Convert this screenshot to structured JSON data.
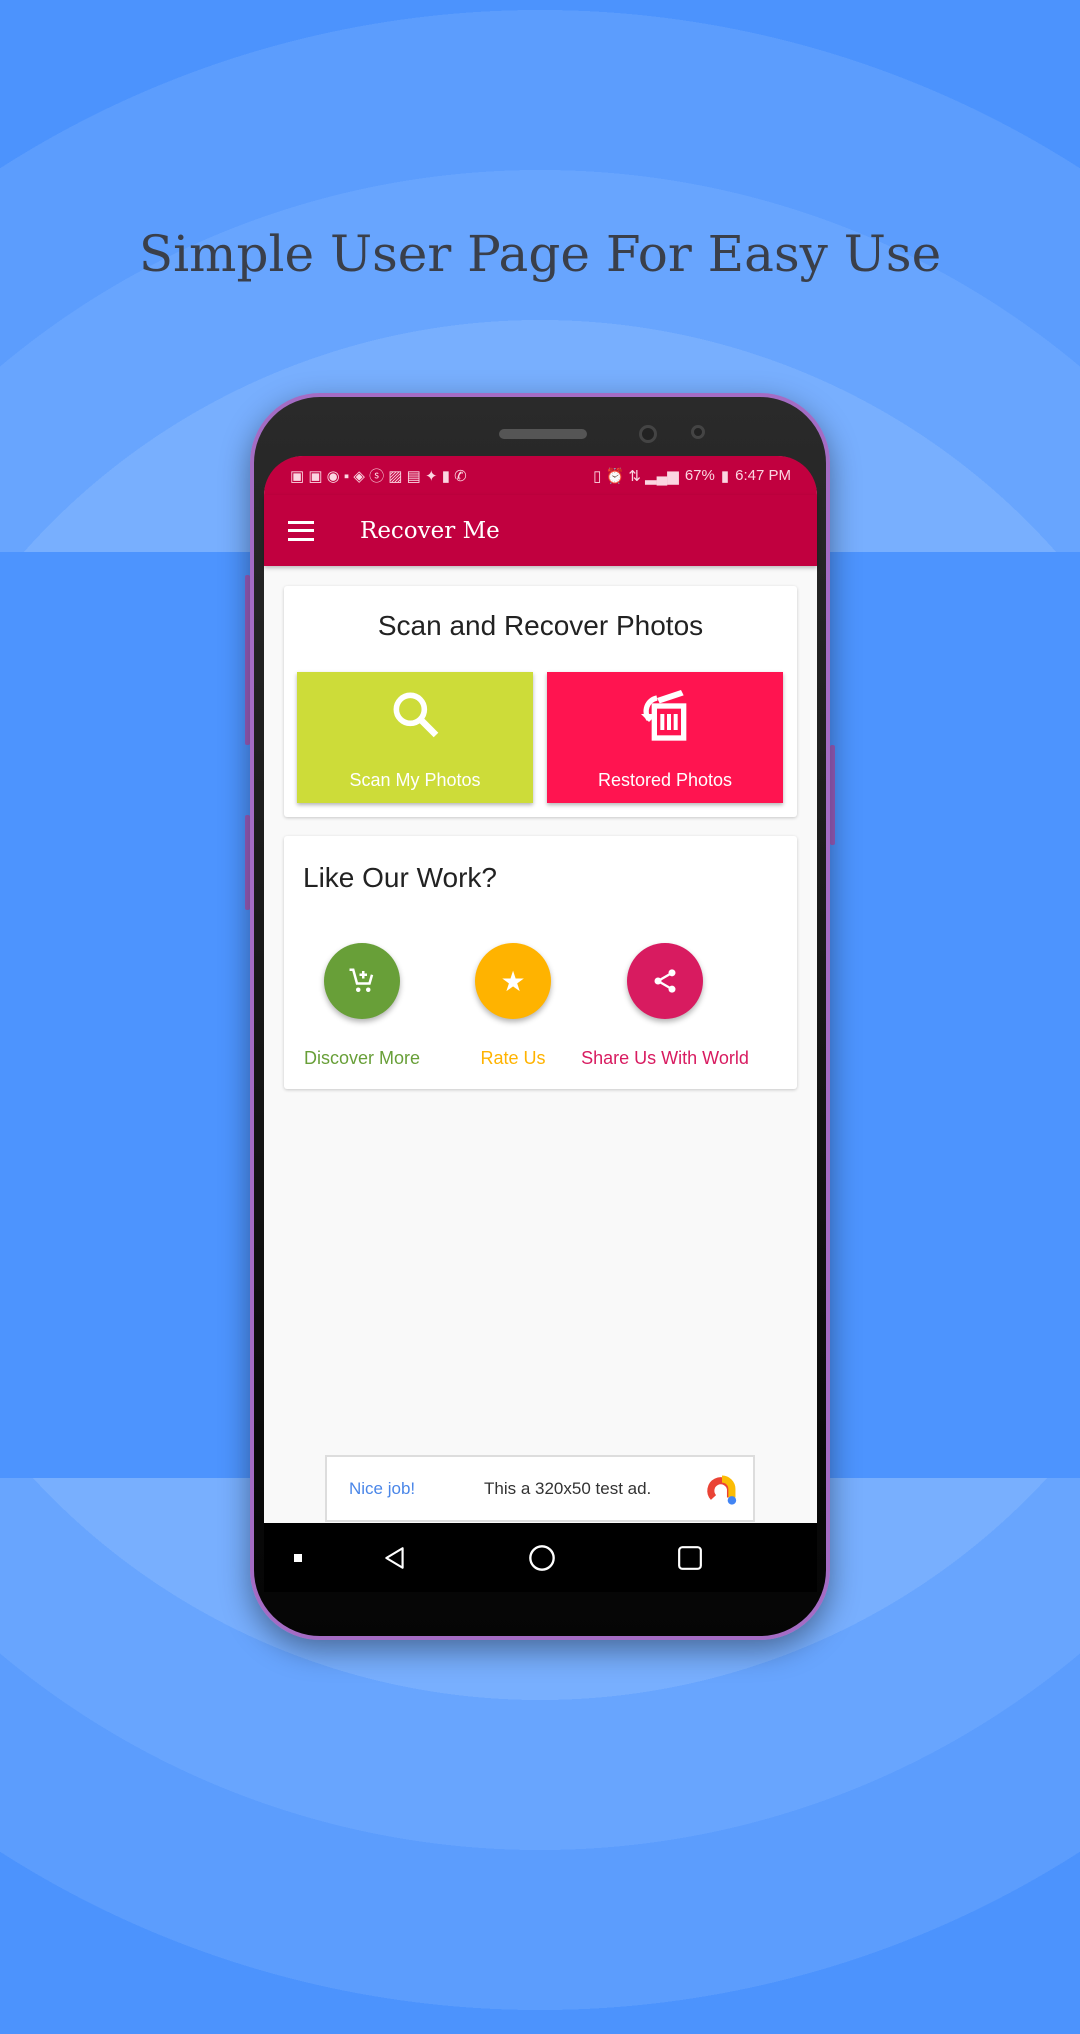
{
  "headline": "Simple User Page For Easy Use",
  "colors": {
    "background": "#4c93fd",
    "app_bar": "#c1003f",
    "scan": "#cddc39",
    "restored": "#ff1450",
    "discover": "#689f38",
    "rate": "#ffb300",
    "share": "#d81b60"
  },
  "status_bar": {
    "battery": "67%",
    "time": "6:47 PM"
  },
  "app_bar": {
    "title": "Recover Me",
    "menu_icon": "hamburger-icon"
  },
  "scan_card": {
    "title": "Scan and Recover Photos",
    "scan_label": "Scan My Photos",
    "restored_label": "Restored Photos"
  },
  "like_card": {
    "title": "Like Our Work?",
    "discover_label": "Discover More",
    "rate_label": "Rate Us",
    "share_label": "Share Us With World"
  },
  "ad": {
    "headline": "Nice job!",
    "text": "This a 320x50 test ad."
  }
}
